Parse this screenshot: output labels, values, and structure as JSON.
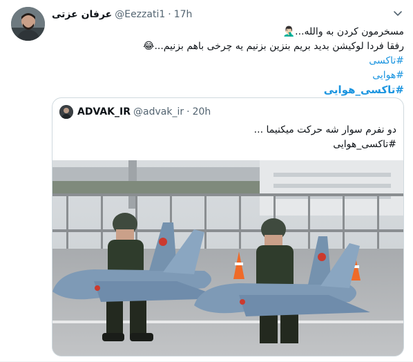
{
  "tweet": {
    "author_name": "عرفان عزتی",
    "handle": "@Eezzati1",
    "separator": "·",
    "time": "17h",
    "lines": [
      "مسخرمون کردن به والله...🤦🏻‍♂️",
      "رفقا فردا لوکیشن بدید بریم بنزین بزنیم یه چرخی باهم بزنیم...😂",
      "#تاکسی",
      "#هوایی",
      "#تاکسی_هوایی"
    ],
    "more_icon": "chevron-down-icon"
  },
  "quoted": {
    "author_name": "ADVAK_IR",
    "handle": "@advak_ir",
    "separator": "·",
    "time": "20h",
    "lines": [
      "دو نفرم سوار شه حرکت میکنیما ...",
      "#تاکسی_هوایی"
    ],
    "image_alt": "Two soldiers carrying fighter jet costumes on a road"
  },
  "colors": {
    "link": "#1b95e0",
    "text": "#0f1419",
    "secondary": "#536471",
    "border": "#cfd9de"
  }
}
